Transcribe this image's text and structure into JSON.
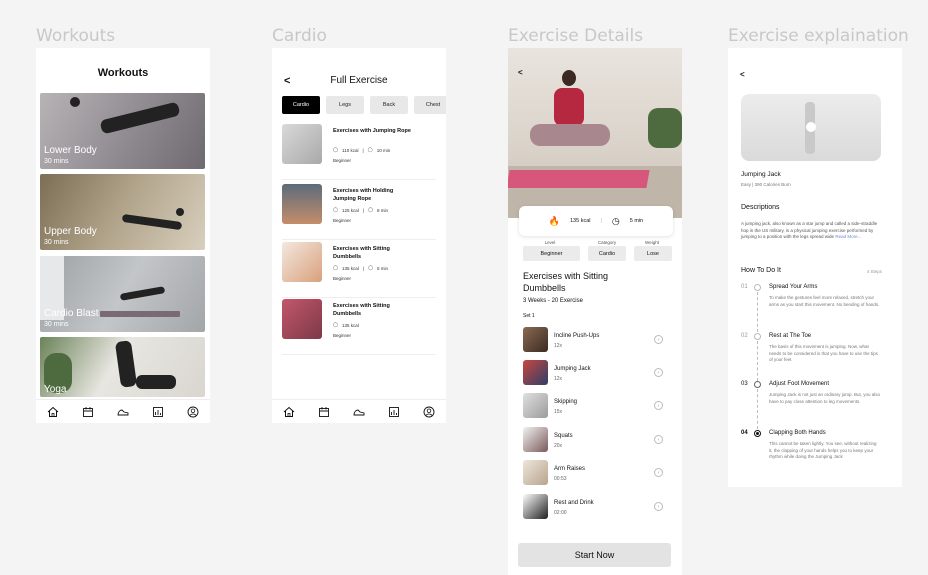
{
  "frames": {
    "workouts": "Workouts",
    "cardio": "Cardio",
    "details": "Exercise Details",
    "explanation": "Exercise explaination"
  },
  "workouts_screen": {
    "header": "Workouts",
    "cards": [
      {
        "name": "Lower Body",
        "duration": "30 mins"
      },
      {
        "name": "Upper Body",
        "duration": "30 mins"
      },
      {
        "name": "Cardio Blast",
        "duration": "30 mins"
      },
      {
        "name": "Yoga",
        "duration": ""
      }
    ]
  },
  "nav": [
    "home-icon",
    "calendar-icon",
    "shoe-icon",
    "stats-icon",
    "profile-icon"
  ],
  "cardio_screen": {
    "back": "<",
    "header": "Full Exercise",
    "chips": [
      "Cardio",
      "Legs",
      "Back",
      "Chest"
    ],
    "exercises": [
      {
        "title": "Exercises with Jumping Rope",
        "kcal": "110 kcal",
        "time": "10 min",
        "level": "Beginner"
      },
      {
        "title": "Exercises with Holding Jumping Rope",
        "kcal": "125 kcal",
        "time": "8 min",
        "level": "Beginner"
      },
      {
        "title": "Exercises with Sitting Dumbbells",
        "kcal": "135 kcal",
        "time": "5 min",
        "level": "Beginner"
      },
      {
        "title": "Exercises with Sitting Dumbbells",
        "kcal": "135 kcal",
        "time": "5 min",
        "level": "Beginner"
      }
    ]
  },
  "details_screen": {
    "back": "<",
    "kcal": "135 kcal",
    "time": "5 min",
    "level_label": "Level",
    "level": "Beginner",
    "category_label": "Category",
    "category": "Cardio",
    "weight_label": "Weight",
    "weight": "Lose",
    "title": "Exercises with Sitting Dumbbells",
    "subtitle": "3 Weeks - 20 Exercise",
    "set": "Set 1",
    "steps": [
      {
        "name": "Incline Push-Ups",
        "value": "12x"
      },
      {
        "name": "Jumping Jack",
        "value": "12x"
      },
      {
        "name": "Skipping",
        "value": "15x"
      },
      {
        "name": "Squats",
        "value": "20x"
      },
      {
        "name": "Arm Raises",
        "value": "00:53"
      },
      {
        "name": "Rest and Drink",
        "value": "02:00"
      }
    ],
    "start": "Start Now"
  },
  "explanation_screen": {
    "back": "<",
    "title": "Jumping Jack",
    "subtitle": "Easy | 390 Calories Burn",
    "desc_heading": "Descriptions",
    "desc": "A jumping jack, also known as a star jump and called a side-straddle hop in the US military, is a physical jumping exercise performed by jumping to a position with the legs spread wide",
    "read_more": "Read More...",
    "how_heading": "How To Do It",
    "steps_count": "4 Steps",
    "steps": [
      {
        "num": "01",
        "name": "Spread Your Arms",
        "text": "To make the gestures feel more relaxed, stretch your arms as you start this movement. No bending of hands."
      },
      {
        "num": "02",
        "name": "Rest at The Toe",
        "text": "The basis of this movement is jumping. Now, what needs to be considered is that you have to use the tips of your feet"
      },
      {
        "num": "03",
        "name": "Adjust Foot Movement",
        "text": "Jumping Jack is not just an ordinary jump. But, you also have to pay close attention to leg movements."
      },
      {
        "num": "04",
        "name": "Clapping Both Hands",
        "text": "This cannot be taken lightly. You see, without realizing it, the clapping of your hands helps you to keep your rhythm while doing the Jumping Jack"
      }
    ]
  }
}
